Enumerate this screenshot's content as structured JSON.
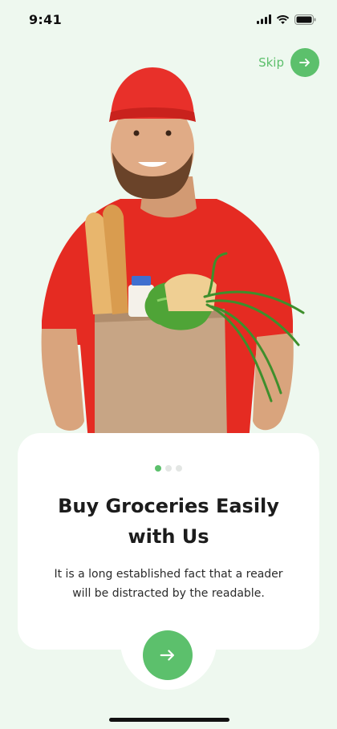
{
  "status_bar": {
    "time": "9:41"
  },
  "onboarding": {
    "skip_label": "Skip",
    "title_line1": "Buy Groceries Easily",
    "title_line2": "with Us",
    "description_line1": "It is a long established fact that a reader",
    "description_line2": "will be distracted by the readable.",
    "page_indicator": {
      "total": 3,
      "current": 1
    }
  },
  "colors": {
    "accent": "#5cc06c",
    "background": "#eef8ef",
    "card": "#ffffff",
    "title_text": "#1c1c1c"
  },
  "icons": {
    "skip": "arrow-right-icon",
    "next": "arrow-right-icon",
    "signal": "cellular-signal-icon",
    "wifi": "wifi-icon",
    "battery": "battery-icon"
  }
}
